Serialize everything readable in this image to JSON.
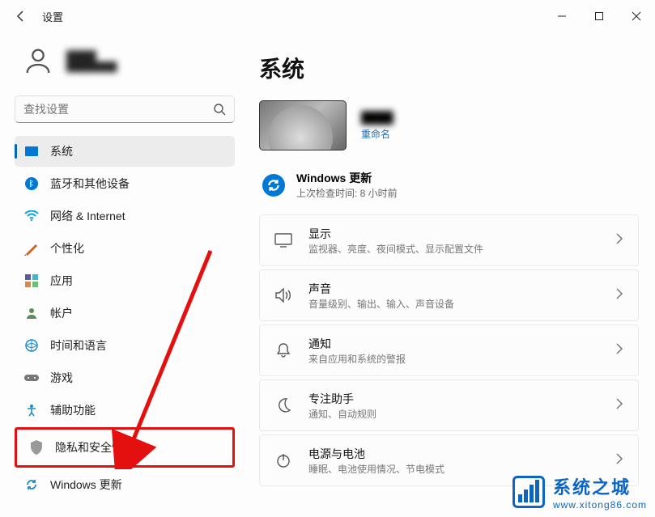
{
  "titlebar": {
    "title": "设置"
  },
  "user": {
    "name": "████",
    "sub": "████████"
  },
  "search": {
    "placeholder": "查找设置"
  },
  "sidebar": {
    "items": [
      {
        "label": "系统"
      },
      {
        "label": "蓝牙和其他设备"
      },
      {
        "label": "网络 & Internet"
      },
      {
        "label": "个性化"
      },
      {
        "label": "应用"
      },
      {
        "label": "帐户"
      },
      {
        "label": "时间和语言"
      },
      {
        "label": "游戏"
      },
      {
        "label": "辅助功能"
      },
      {
        "label": "隐私和安全性"
      },
      {
        "label": "Windows 更新"
      }
    ]
  },
  "main": {
    "page_title": "系统",
    "device": {
      "name": "████",
      "rename": "重命名"
    },
    "update": {
      "title": "Windows 更新",
      "subtitle": "上次检查时间: 8 小时前"
    },
    "cards": [
      {
        "title": "显示",
        "subtitle": "监视器、亮度、夜间模式、显示配置文件"
      },
      {
        "title": "声音",
        "subtitle": "音量级别、输出、输入、声音设备"
      },
      {
        "title": "通知",
        "subtitle": "来自应用和系统的警报"
      },
      {
        "title": "专注助手",
        "subtitle": "通知、自动规则"
      },
      {
        "title": "电源与电池",
        "subtitle": "睡眠、电池使用情况、节电模式"
      }
    ]
  },
  "watermark": {
    "line1": "系统之城",
    "line2": "www.xitong86.com"
  }
}
